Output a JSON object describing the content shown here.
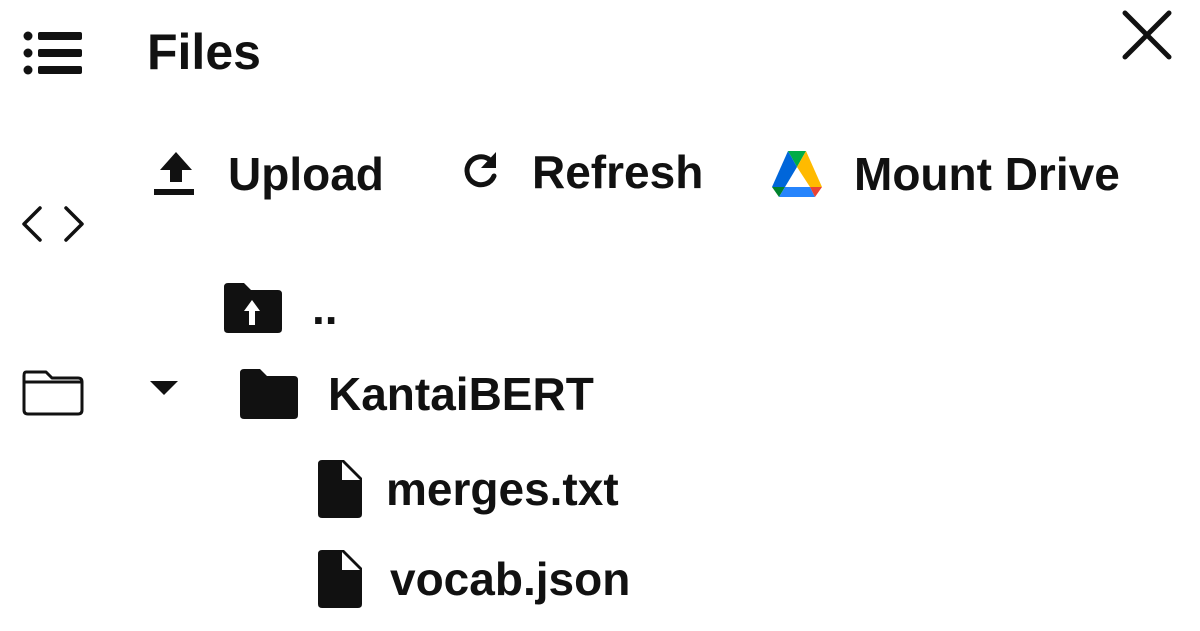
{
  "header": {
    "title": "Files",
    "close_icon": "close-icon",
    "menu_icon": "menu-list-icon"
  },
  "side_icons": [
    "menu-list-icon",
    "code-brackets-icon",
    "folder-outline-icon"
  ],
  "toolbar": {
    "upload_label": "Upload",
    "refresh_label": "Refresh",
    "mount_drive_label": "Mount Drive",
    "upload_icon": "upload-icon",
    "refresh_icon": "refresh-icon",
    "drive_icon": "google-drive-icon",
    "drive_colors": [
      "#0066DA",
      "#00AC47",
      "#EA4335",
      "#00832D",
      "#2684FC",
      "#FFBA00"
    ]
  },
  "tree": {
    "parent": {
      "label": "..",
      "icon": "folder-up-icon"
    },
    "folder": {
      "label": "KantaiBERT",
      "icon": "folder-icon",
      "expanded": true
    },
    "files": [
      {
        "label": "merges.txt",
        "icon": "file-icon"
      },
      {
        "label": "vocab.json",
        "icon": "file-icon"
      }
    ]
  }
}
